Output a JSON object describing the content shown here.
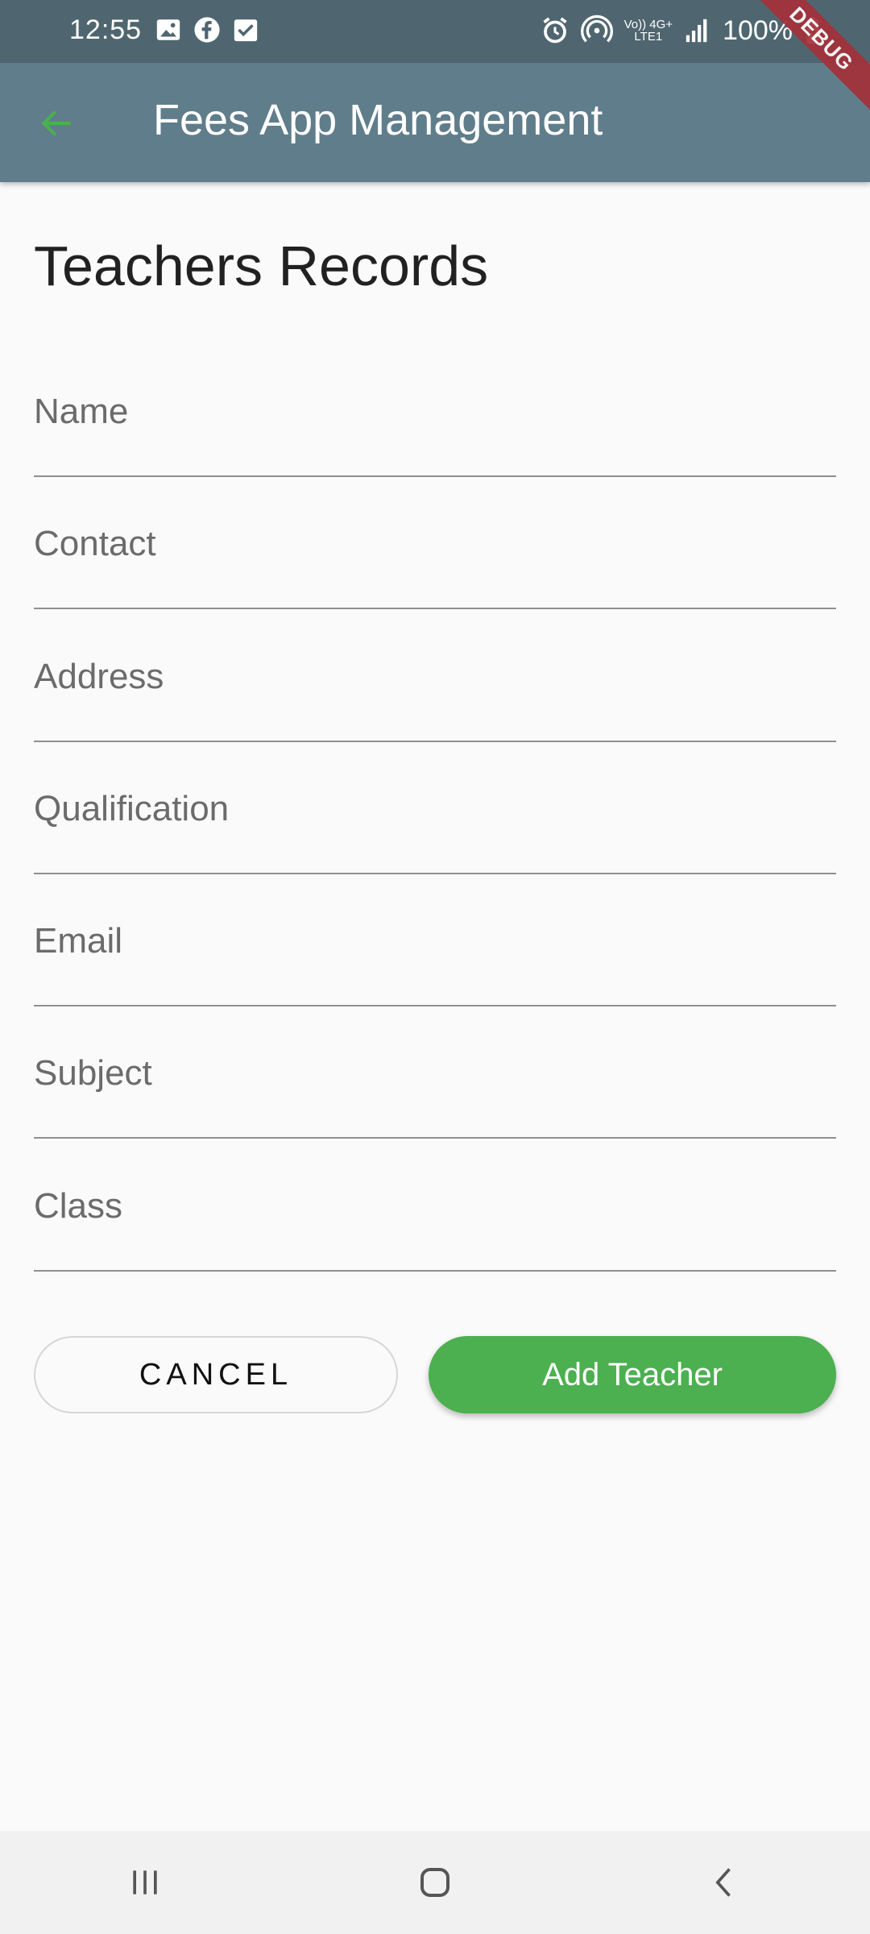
{
  "status_bar": {
    "time": "12:55",
    "battery": "100%",
    "network_top": "Vo)) 4G+",
    "network_bottom": "LTE1"
  },
  "debug_banner": "DEBUG",
  "app_bar": {
    "title": "Fees App Management"
  },
  "page": {
    "title": "Teachers Records"
  },
  "form": {
    "fields": [
      {
        "placeholder": "Name",
        "value": ""
      },
      {
        "placeholder": "Contact",
        "value": ""
      },
      {
        "placeholder": "Address",
        "value": ""
      },
      {
        "placeholder": "Qualification",
        "value": ""
      },
      {
        "placeholder": "Email",
        "value": ""
      },
      {
        "placeholder": "Subject",
        "value": ""
      },
      {
        "placeholder": "Class",
        "value": ""
      }
    ]
  },
  "buttons": {
    "cancel": "CANCEL",
    "add": "Add Teacher"
  },
  "colors": {
    "status_bar": "#4f6670",
    "app_bar": "#607d8b",
    "accent_green": "#4caf50",
    "debug_red": "#a4303a"
  }
}
